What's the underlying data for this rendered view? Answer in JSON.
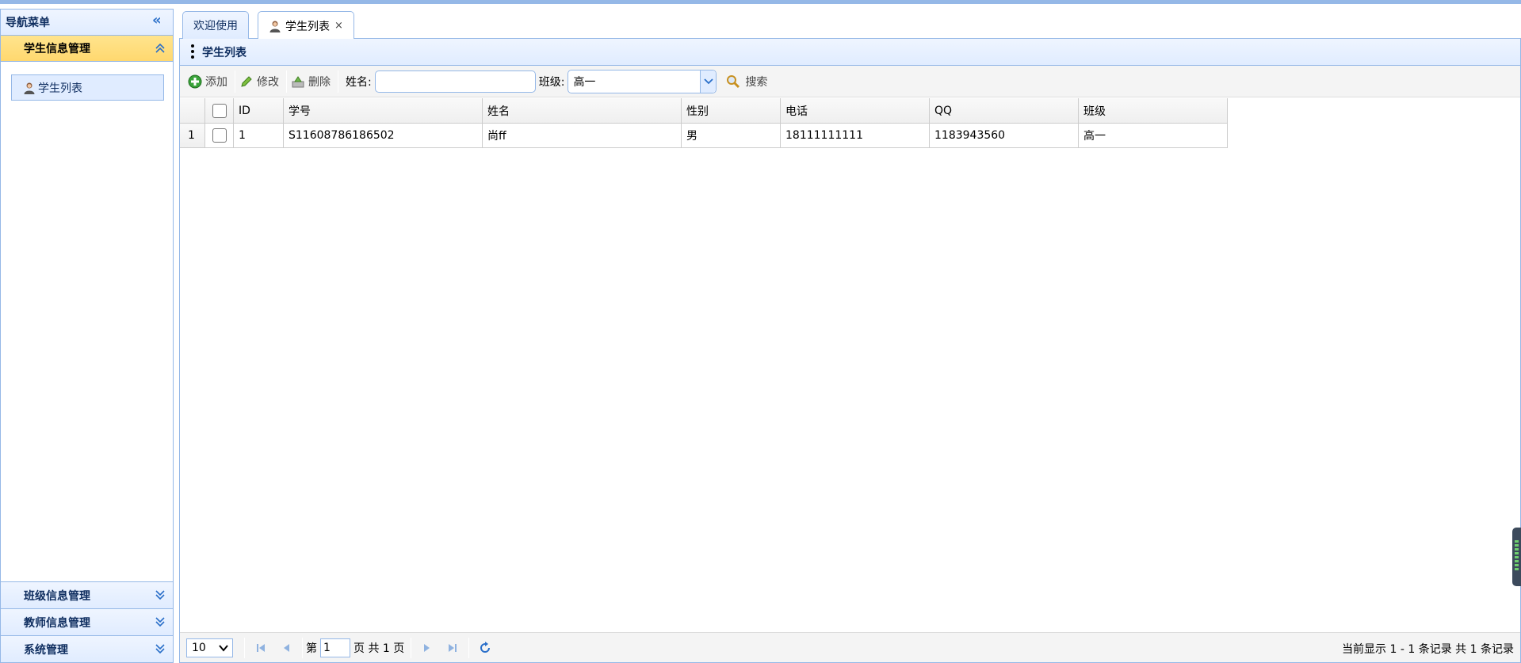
{
  "nav": {
    "title": "导航菜单",
    "sections": [
      {
        "label": "学生信息管理",
        "expanded": true,
        "items": [
          {
            "label": "学生列表",
            "icon": "user-icon"
          }
        ]
      },
      {
        "label": "班级信息管理",
        "expanded": false
      },
      {
        "label": "教师信息管理",
        "expanded": false
      },
      {
        "label": "系统管理",
        "expanded": false
      }
    ]
  },
  "tabs": [
    {
      "label": "欢迎使用",
      "active": false
    },
    {
      "label": "学生列表",
      "active": true,
      "closable": true,
      "close_glyph": "×"
    }
  ],
  "panel": {
    "title": "学生列表",
    "toolbar": {
      "add_label": "添加",
      "edit_label": "修改",
      "delete_label": "删除",
      "name_label": "姓名:",
      "name_value": "",
      "class_label": "班级:",
      "class_selected": "高一",
      "search_label": "搜索"
    },
    "grid": {
      "columns": [
        "ID",
        "学号",
        "姓名",
        "性别",
        "电话",
        "QQ",
        "班级"
      ],
      "rows": [
        {
          "rownum": "1",
          "checked": false,
          "cells": [
            "1",
            "S11608786186502",
            "尚ff",
            "男",
            "18111111111",
            "1183943560",
            "高一"
          ]
        }
      ]
    },
    "pager": {
      "page_size": "10",
      "page_prefix": "第",
      "page_value": "1",
      "page_suffix": "页 共 1 页",
      "info": "当前显示 1 - 1 条记录 共 1 条记录"
    }
  },
  "colors": {
    "border": "#95b8e7",
    "header_bg": "#e0ecff",
    "accordion_active": "#ffd86f",
    "title_text": "#0e2d5f"
  }
}
